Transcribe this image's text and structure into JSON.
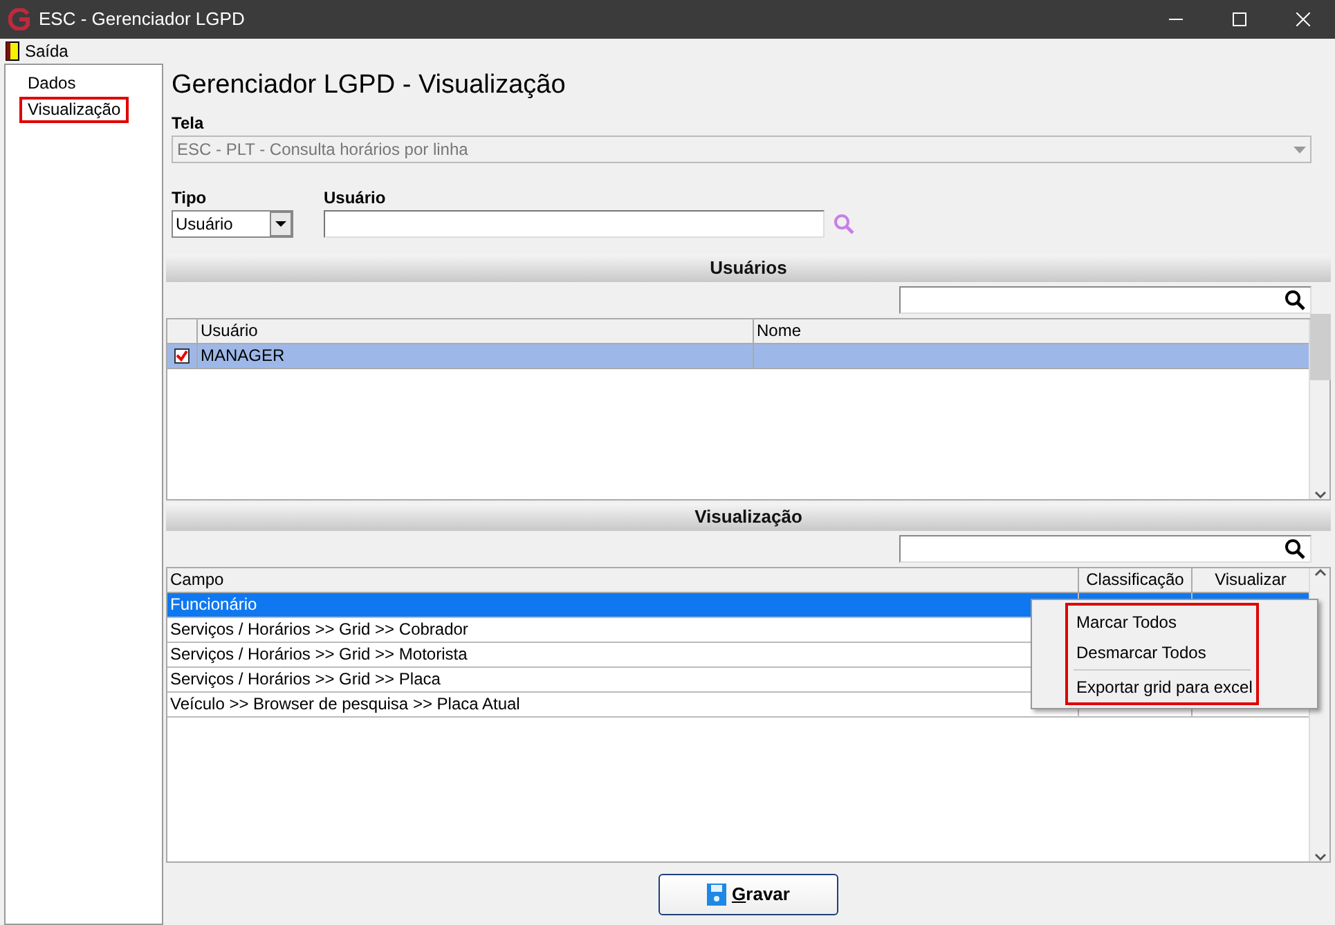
{
  "window": {
    "title": "ESC - Gerenciador LGPD"
  },
  "menu": [
    {
      "label": "Saída"
    }
  ],
  "tree": [
    {
      "label": "Dados",
      "selected": false
    },
    {
      "label": "Visualização",
      "selected": true
    }
  ],
  "heading": "Gerenciador LGPD - Visualização",
  "tela": {
    "label": "Tela",
    "value": "ESC - PLT - Consulta horários por linha",
    "disabled": true
  },
  "tipo": {
    "label": "Tipo",
    "value": "Usuário"
  },
  "usuario": {
    "label": "Usuário"
  },
  "users_section": {
    "title": "Usuários",
    "columns": [
      "Usuário",
      "Nome"
    ],
    "rows": [
      {
        "usuario": "MANAGER",
        "nome": "",
        "checked": true,
        "selected": true
      }
    ]
  },
  "view_section": {
    "title": "Visualização",
    "columns": [
      "Campo",
      "Classificação",
      "Visualizar"
    ],
    "rows": [
      {
        "campo": "Funcionário",
        "selected": true
      },
      {
        "campo": "Serviços / Horários >> Grid >> Cobrador",
        "selected": false
      },
      {
        "campo": "Serviços / Horários >> Grid >> Motorista",
        "selected": false
      },
      {
        "campo": "Serviços / Horários >> Grid >> Placa",
        "selected": false
      },
      {
        "campo": "Veículo >> Browser de pesquisa >> Placa Atual",
        "selected": false
      }
    ]
  },
  "context_menu": [
    {
      "label": "Marcar Todos",
      "kind": "item"
    },
    {
      "label": "Desmarcar Todos",
      "kind": "item"
    },
    {
      "kind": "separator"
    },
    {
      "label": "Exportar grid para excel",
      "kind": "item"
    }
  ],
  "save_button": "Gravar"
}
